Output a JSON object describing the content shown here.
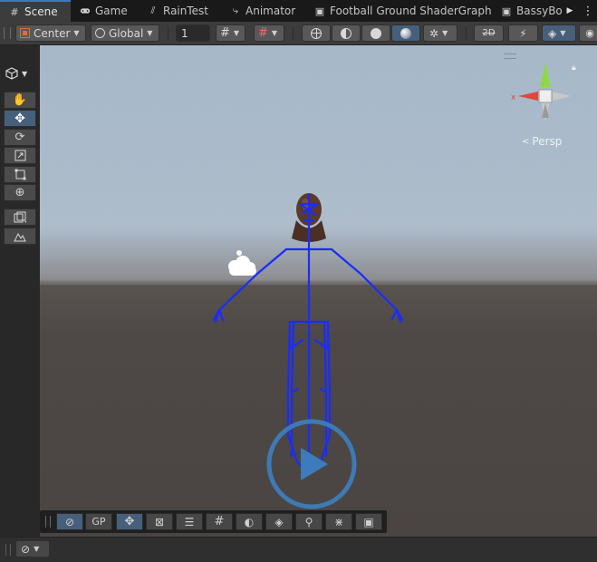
{
  "tabs": [
    {
      "label": "Scene",
      "icon": "grid-icon",
      "active": true
    },
    {
      "label": "Game",
      "icon": "gamepad-icon"
    },
    {
      "label": "RainTest",
      "icon": "script-icon"
    },
    {
      "label": "Animator",
      "icon": "animator-icon"
    },
    {
      "label": "Football Ground ShaderGraph",
      "icon": "shadergraph-icon"
    },
    {
      "label": "BassyBo",
      "icon": "shadergraph-icon"
    }
  ],
  "toolbar": {
    "pivot_label": "Center",
    "space_label": "Global",
    "grid_size_value": "1"
  },
  "viewport": {
    "projection_label": "Persp",
    "axis_x_label": "x",
    "axis_y_label": "y"
  },
  "overlay_bar": {
    "gp_label": "GP"
  },
  "colors": {
    "accent": "#46607c",
    "skeleton": "#1a2cff",
    "play_ring": "#3d7fc0",
    "sky": "#aebccb",
    "ground": "#4e4846"
  }
}
